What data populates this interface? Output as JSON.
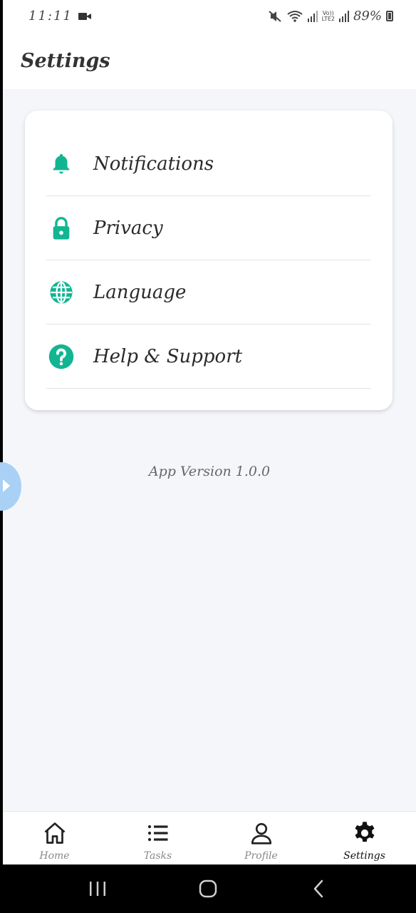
{
  "status_bar": {
    "time": "11:11",
    "lte_top": "Vo))",
    "lte_bottom": "LTE2",
    "battery": "89%"
  },
  "header": {
    "title": "Settings"
  },
  "settings_menu": {
    "items": [
      {
        "label": "Notifications",
        "icon": "bell-icon"
      },
      {
        "label": "Privacy",
        "icon": "lock-icon"
      },
      {
        "label": "Language",
        "icon": "globe-icon"
      },
      {
        "label": "Help & Support",
        "icon": "help-icon"
      }
    ]
  },
  "app_version": "App Version 1.0.0",
  "bottom_nav": {
    "items": [
      {
        "label": "Home",
        "icon": "home-icon"
      },
      {
        "label": "Tasks",
        "icon": "list-icon"
      },
      {
        "label": "Profile",
        "icon": "user-icon"
      },
      {
        "label": "Settings",
        "icon": "gear-icon",
        "active": true
      }
    ]
  },
  "colors": {
    "accent": "#12b591",
    "background": "#f4f6fa",
    "card": "#ffffff"
  }
}
